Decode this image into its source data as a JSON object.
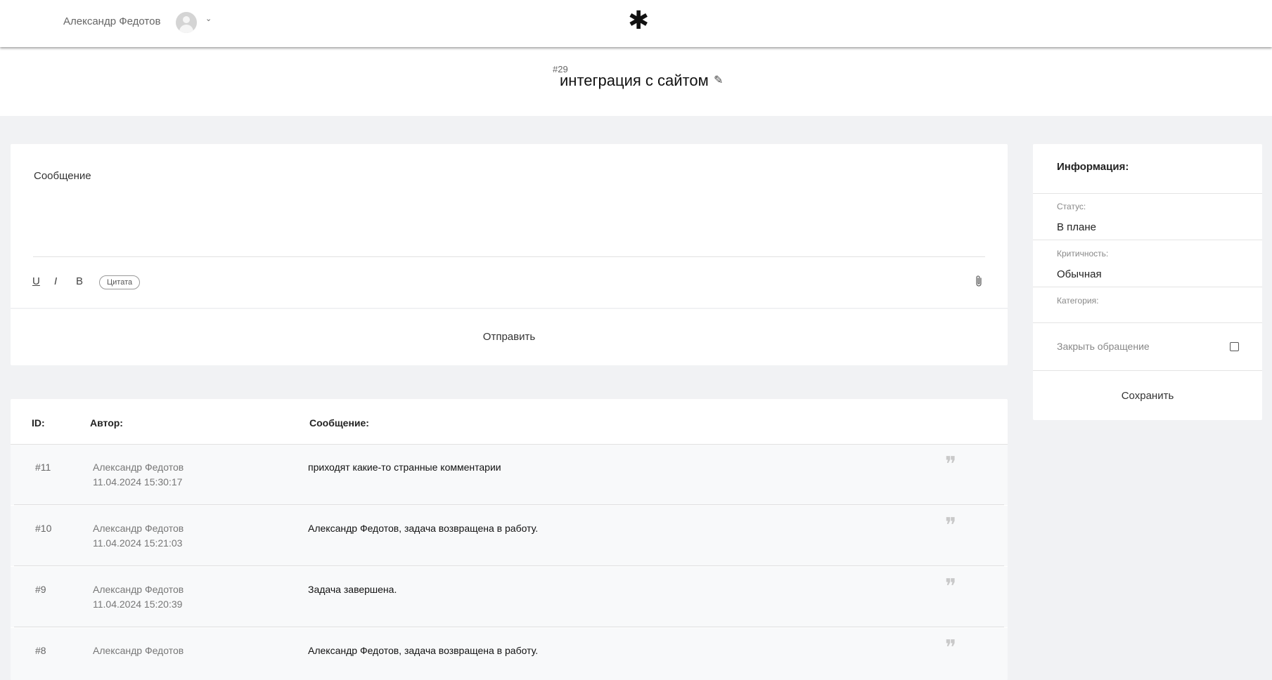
{
  "header": {
    "user_name": "Александр Федотов",
    "avatar_icon": "user-avatar-icon",
    "menu_chevron": "⌄",
    "logo": "✱"
  },
  "ticket": {
    "number": "#29",
    "title": "интеграция с сайтом",
    "edit_icon": "pencil-icon"
  },
  "compose": {
    "label": "Сообщение",
    "underline": "U",
    "italic": "I",
    "bold": "B",
    "quote": "Цитата",
    "attach_icon": "paperclip-icon",
    "send": "Отправить"
  },
  "info": {
    "title": "Информация:",
    "status_label": "Статус:",
    "status_value": "В плане",
    "priority_label": "Критичность:",
    "priority_value": "Обычная",
    "category_label": "Категория:",
    "close_label": "Закрыть обращение",
    "close_checked": false,
    "save": "Сохранить"
  },
  "messages": {
    "headers": {
      "id": "ID:",
      "author": "Автор:",
      "message": "Сообщение:"
    },
    "rows": [
      {
        "id": "#11",
        "author": "Александр Федотов",
        "date": "11.04.2024 15:30:17",
        "text": "приходят какие-то странные комментарии"
      },
      {
        "id": "#10",
        "author": "Александр Федотов",
        "date": "11.04.2024 15:21:03",
        "text": "Александр Федотов, задача возвращена в работу."
      },
      {
        "id": "#9",
        "author": "Александр Федотов",
        "date": "11.04.2024 15:20:39",
        "text": "Задача завершена."
      },
      {
        "id": "#8",
        "author": "Александр Федотов",
        "date": "",
        "text": "Александр Федотов, задача возвращена в работу."
      }
    ]
  },
  "colors": {
    "background": "#f1f2f4",
    "panel": "#ffffff",
    "row": "#f8f9fa"
  }
}
